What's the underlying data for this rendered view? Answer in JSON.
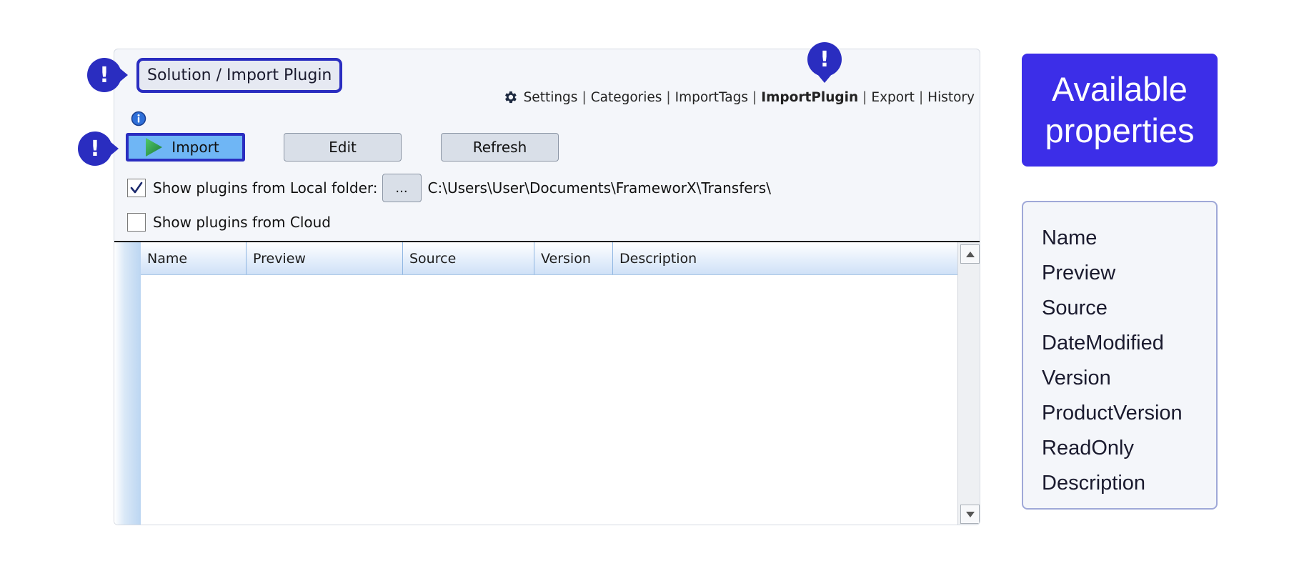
{
  "window": {
    "breadcrumb": "Solution / Import Plugin",
    "nav_links": [
      {
        "label": "Settings",
        "active": false
      },
      {
        "label": "Categories",
        "active": false
      },
      {
        "label": "ImportTags",
        "active": false
      },
      {
        "label": "ImportPlugin",
        "active": true
      },
      {
        "label": "Export",
        "active": false
      },
      {
        "label": "History",
        "active": false
      }
    ],
    "nav_separator": "|",
    "toolbar": {
      "import_label": "Import",
      "edit_label": "Edit",
      "refresh_label": "Refresh"
    },
    "local_folder": {
      "label": "Show plugins from Local folder:",
      "checked": true,
      "browse_label": "...",
      "path": "C:\\Users\\User\\Documents\\FrameworX\\Transfers\\"
    },
    "cloud": {
      "label": "Show plugins from Cloud",
      "checked": false
    },
    "grid": {
      "columns": [
        "Name",
        "Preview",
        "Source",
        "Version",
        "Description"
      ],
      "rows": []
    }
  },
  "markers": {
    "symbol": "!",
    "color": "#2a2dc0"
  },
  "properties_panel": {
    "title_line1": "Available",
    "title_line2": "properties",
    "items": [
      "Name",
      "Preview",
      "Source",
      "DateModified",
      "Version",
      "ProductVersion",
      "ReadOnly",
      "Description"
    ]
  },
  "colors": {
    "accent": "#2a2dc0",
    "title_bg": "#3c2ee8",
    "import_button": "#6fb6f5"
  }
}
